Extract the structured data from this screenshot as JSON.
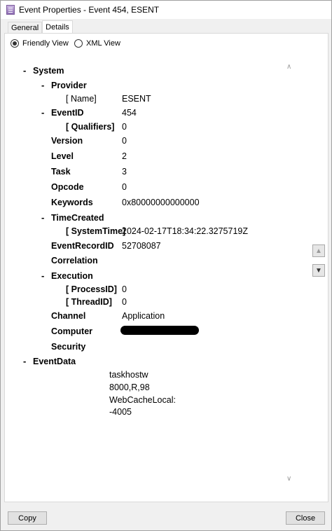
{
  "window": {
    "title": "Event Properties - Event 454, ESENT"
  },
  "tabs": [
    {
      "label": "General"
    },
    {
      "label": "Details"
    }
  ],
  "view_options": {
    "friendly": "Friendly View",
    "xml": "XML View",
    "selected": "Friendly View"
  },
  "tree": {
    "system": "System",
    "provider": "Provider",
    "name_key": "[ Name]",
    "name_val": "ESENT",
    "eventid": "EventID",
    "eventid_val": "454",
    "qualifiers_key": "[ Qualifiers]",
    "qualifiers_val": "0",
    "version": "Version",
    "version_val": "0",
    "level": "Level",
    "level_val": "2",
    "task": "Task",
    "task_val": "3",
    "opcode": "Opcode",
    "opcode_val": "0",
    "keywords": "Keywords",
    "keywords_val": "0x80000000000000",
    "timecreated": "TimeCreated",
    "systemtime_key": "[ SystemTime]",
    "systemtime_val": "2024-02-17T18:34:22.3275719Z",
    "eventrecordid": "EventRecordID",
    "eventrecordid_val": "52708087",
    "correlation": "Correlation",
    "execution": "Execution",
    "processid_key": "[ ProcessID]",
    "processid_val": "0",
    "threadid_key": "[ ThreadID]",
    "threadid_val": "0",
    "channel": "Channel",
    "channel_val": "Application",
    "computer": "Computer",
    "security": "Security",
    "eventdata": "EventData",
    "eventdata_lines": [
      "taskhostw",
      "8000,R,98",
      "WebCacheLocal:",
      "-4005"
    ]
  },
  "buttons": {
    "copy": "Copy",
    "close": "Close"
  }
}
